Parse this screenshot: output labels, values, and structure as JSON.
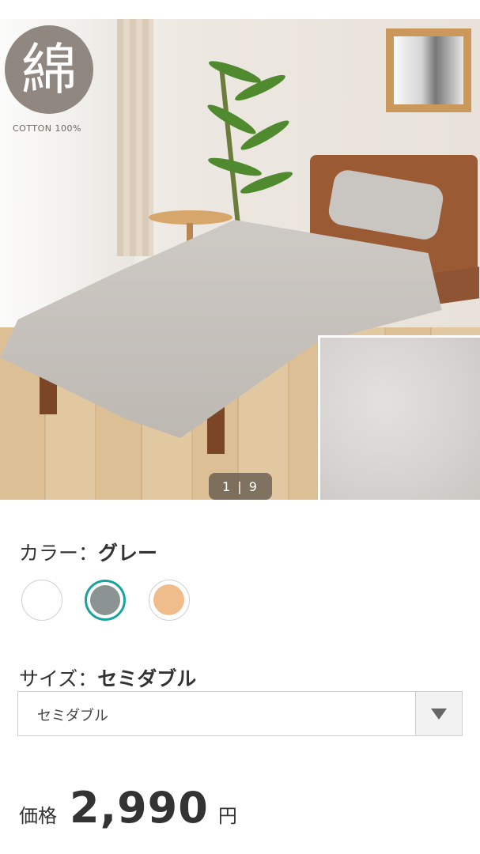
{
  "gallery": {
    "badge_kanji": "綿",
    "badge_text": "COTTON 100%",
    "page_indicator": "1 | 9",
    "current_page": 1,
    "total_pages": 9
  },
  "color": {
    "label": "カラー：",
    "selected": "グレー",
    "swatches": [
      {
        "name": "white",
        "hex": "#ffffff",
        "selected": false
      },
      {
        "name": "gray",
        "hex": "#8b9393",
        "selected": true
      },
      {
        "name": "beige",
        "hex": "#efbd8b",
        "selected": false
      }
    ],
    "accent": "#1aa39a"
  },
  "size": {
    "label": "サイズ：",
    "selected": "セミダブル",
    "select_value": "セミダブル"
  },
  "price": {
    "label": "価格",
    "value": "2,990",
    "unit": "円"
  }
}
